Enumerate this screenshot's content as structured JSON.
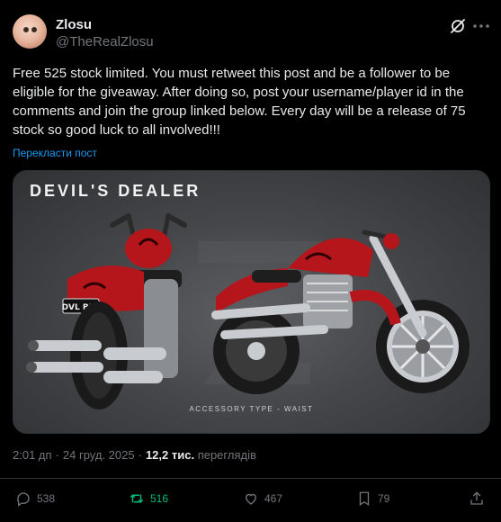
{
  "author": {
    "name": "Zlosu",
    "handle": "@TheRealZlosu"
  },
  "post": {
    "text": "Free 525 stock limited. You must retweet this post and be a follower to be eligible for the giveaway. After doing so, post your username/player id in the comments and join the group linked below. Every day will be a release of 75 stock so good luck to all involved!!!",
    "translate_label": "Перекласти пост"
  },
  "media": {
    "title": "DEVIL'S DEALER",
    "plate": "DVL BLR",
    "caption": "ACCESSORY TYPE -  WAIST",
    "colors": {
      "paint": "#b4161b",
      "chrome": "#c8ccd0",
      "tire": "#1a1a1a"
    }
  },
  "meta": {
    "time": "2:01 дп",
    "date": "24 груд. 2025",
    "views_count": "12,2 тис.",
    "views_label": "переглядів"
  },
  "actions": {
    "replies": "538",
    "reposts": "516",
    "likes": "467",
    "bookmarks": "79"
  },
  "icons": [
    "grok-icon",
    "more-icon",
    "reply-icon",
    "repost-icon",
    "like-icon",
    "bookmark-icon",
    "share-icon"
  ]
}
